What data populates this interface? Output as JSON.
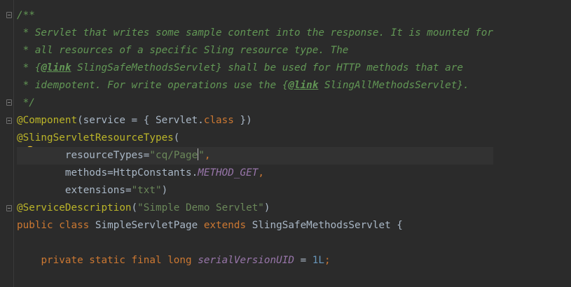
{
  "editor": {
    "lines": {
      "l1": {
        "t1": "/**"
      },
      "l2": {
        "t1": " * Servlet that writes some sample content into the response. It is mounted for"
      },
      "l3": {
        "t1": " * all resources of a specific Sling resource type. The"
      },
      "l4": {
        "t1": " * {",
        "tag": "@link",
        "t2": " SlingSafeMethodsServlet} shall be used for HTTP methods that are"
      },
      "l5": {
        "t1": " * idempotent. For write operations use the {",
        "tag": "@link",
        "t2": " SlingAllMethodsServlet}."
      },
      "l6": {
        "t1": " */"
      },
      "l7": {
        "annot": "@Component",
        "t1": "(service = { Servlet.",
        "kw": "class",
        "t2": " })"
      },
      "l8": {
        "annot": "@SlingServletResourceTypes",
        "t1": "("
      },
      "l9": {
        "indent": "        ",
        "name": "resourceTypes=",
        "str1": "\"cq/Page",
        "str2": "\"",
        "comma": ","
      },
      "l10": {
        "indent": "        ",
        "name": "methods=HttpConstants.",
        "const": "METHOD_GET",
        "comma": ","
      },
      "l11": {
        "indent": "        ",
        "name": "extensions=",
        "str": "\"txt\"",
        "close": ")"
      },
      "l12": {
        "annot": "@ServiceDescription",
        "t1": "(",
        "str": "\"Simple Demo Servlet\"",
        "t2": ")"
      },
      "l13": {
        "kw1": "public class",
        "t1": " SimpleServletPage ",
        "kw2": "extends",
        "t2": " SlingSafeMethodsServlet {"
      },
      "l15": {
        "indent": "    ",
        "kw": "private static final long",
        "sp": " ",
        "const": "serialVersionUID",
        "t1": " = ",
        "num": "1L",
        "semi": ";"
      }
    }
  },
  "icons": {
    "fold": "fold-marker-icon",
    "intention": "lightbulb-icon"
  },
  "colors": {
    "background": "#2b2b2b",
    "comment": "#629755",
    "keyword": "#cc7832",
    "annotation": "#bbb529",
    "string": "#6a8759",
    "constant": "#9876aa",
    "number": "#6897bb",
    "text": "#a9b7c6"
  }
}
